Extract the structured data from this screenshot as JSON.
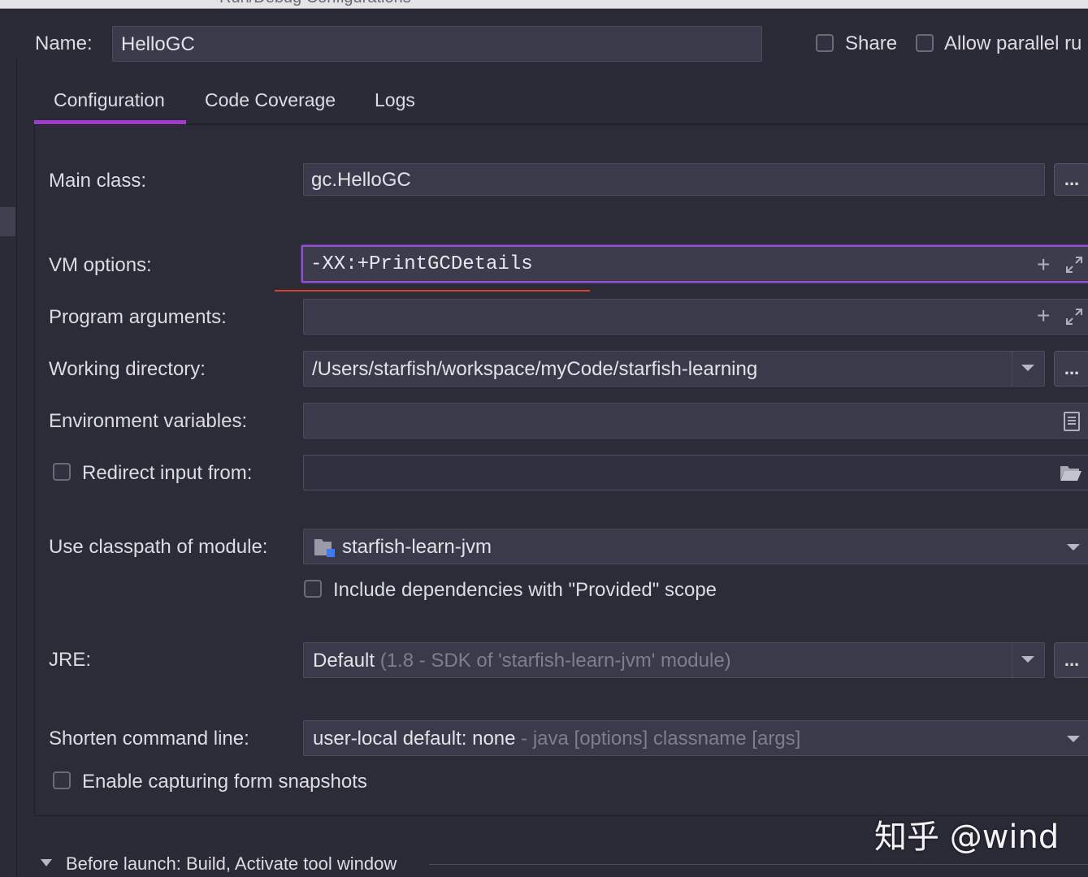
{
  "window": {
    "title_fragment": "Run/Debug Configurations"
  },
  "header": {
    "name_label": "Name:",
    "name_value": "HelloGC",
    "share_label": "Share",
    "allow_parallel_label": "Allow parallel ru"
  },
  "tabs": [
    {
      "label": "Configuration",
      "active": true
    },
    {
      "label": "Code Coverage",
      "active": false
    },
    {
      "label": "Logs",
      "active": false
    }
  ],
  "form": {
    "main_class": {
      "label": "Main class:",
      "value": "gc.HelloGC",
      "button": "..."
    },
    "vm_options": {
      "label": "VM options:",
      "value": "-XX:+PrintGCDetails"
    },
    "program_arguments": {
      "label": "Program arguments:",
      "value": ""
    },
    "working_directory": {
      "label": "Working directory:",
      "value": "/Users/starfish/workspace/myCode/starfish-learning",
      "button": "..."
    },
    "environment_variables": {
      "label": "Environment variables:",
      "value": ""
    },
    "redirect_input": {
      "label": "Redirect input from:",
      "value": ""
    },
    "classpath_module": {
      "label": "Use classpath of module:",
      "value": "starfish-learn-jvm"
    },
    "include_provided": {
      "label": "Include dependencies with \"Provided\" scope"
    },
    "jre": {
      "label": "JRE:",
      "value": "Default",
      "hint": "(1.8 - SDK of 'starfish-learn-jvm' module)",
      "button": "..."
    },
    "shorten_cmd": {
      "label": "Shorten command line:",
      "value": "user-local default: none",
      "hint": "- java [options] classname [args]"
    },
    "capture_snapshots": {
      "label": "Enable capturing form snapshots"
    }
  },
  "before_launch": {
    "label": "Before launch: Build, Activate tool window"
  },
  "watermark": {
    "text": "知乎 @wind"
  },
  "colors": {
    "accent": "#a03cc8",
    "annotation_red": "#d2452a",
    "background": "#2b2b38"
  }
}
